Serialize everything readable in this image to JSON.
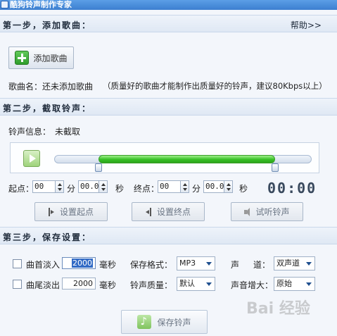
{
  "window": {
    "title": "酷狗铃声制作专家"
  },
  "step1": {
    "title": "第一步，添加歌曲：",
    "help_label": "帮助>>",
    "add_song_label": "添加歌曲",
    "song_name_label": "歌曲名：",
    "song_name_value": "还未添加歌曲",
    "quality_tip": "（质量好的歌曲才能制作出质量好的铃声，建议80Kbps以上）"
  },
  "step2": {
    "title": "第二步，截取铃声：",
    "info_label": "铃声信息：",
    "info_value": "未截取",
    "start_label": "起点：",
    "end_label": "终点：",
    "start_min": "00",
    "start_sec": "00.0",
    "end_min": "00",
    "end_sec": "00.0",
    "unit_min": "分",
    "unit_sec": "秒",
    "time_display": "00:00",
    "set_start_label": "设置起点",
    "set_end_label": "设置终点",
    "preview_label": "试听铃声"
  },
  "step3": {
    "title": "第三步，保存设置：",
    "fade_in_label": "曲首淡入",
    "fade_in_value": "2000",
    "fade_out_label": "曲尾淡出",
    "fade_out_value": "2000",
    "ms_unit": "毫秒",
    "format_label": "保存格式：",
    "format_value": "MP3",
    "quality_label": "铃声质量：",
    "quality_value": "默认",
    "channel_label1": "声",
    "channel_label2": "道：",
    "channel_value": "双声道",
    "gain_label": "声音增大：",
    "gain_value": "原始",
    "save_label": "保存铃声"
  },
  "watermark": "Bai 经验"
}
